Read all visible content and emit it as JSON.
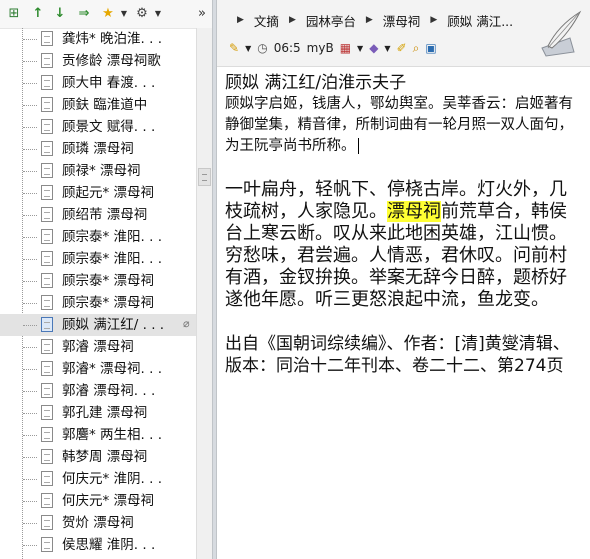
{
  "left_toolbar": {
    "buttons": [
      "add-node",
      "up",
      "down",
      "right",
      "favorite",
      "more"
    ],
    "collapse": "»"
  },
  "tree": {
    "items": [
      {
        "label": "龚炜* 晚泊淮. . ."
      },
      {
        "label": "贡修龄 漂母祠歌"
      },
      {
        "label": "顾大申 春渡. . ."
      },
      {
        "label": "顾鈇 臨淮道中"
      },
      {
        "label": "顾景文 赋得. . ."
      },
      {
        "label": "顾璘 漂母祠"
      },
      {
        "label": "顾禄* 漂母祠"
      },
      {
        "label": "顾起元* 漂母祠"
      },
      {
        "label": "顾绍芾 漂母祠"
      },
      {
        "label": "顾宗泰* 淮阳. . ."
      },
      {
        "label": "顾宗泰* 淮阳. . ."
      },
      {
        "label": "顾宗泰* 漂母祠"
      },
      {
        "label": "顾宗泰* 漂母祠"
      },
      {
        "label": "顾姒 满江红/ . . .",
        "selected": true
      },
      {
        "label": "郭濬 漂母祠"
      },
      {
        "label": "郭濬* 漂母祠. . ."
      },
      {
        "label": "郭濬 漂母祠. . ."
      },
      {
        "label": "郭孔建 漂母祠"
      },
      {
        "label": "郭麐* 两生相. . ."
      },
      {
        "label": "韩梦周 漂母祠"
      },
      {
        "label": "何庆元* 淮阴. . ."
      },
      {
        "label": "何庆元* 漂母祠"
      },
      {
        "label": "贺炌 漂母祠"
      },
      {
        "label": "侯思耀 淮阴. . ."
      }
    ]
  },
  "breadcrumb": [
    "文摘",
    "园林亭台",
    "漂母祠",
    "顾姒 满江..."
  ],
  "toolbar": {
    "time": "06:5",
    "size": "myB"
  },
  "document": {
    "title": "顾姒 满江红/泊淮示夫子",
    "desc": "顾姒字启姬，钱唐人，鄂幼舆室。吴莘香云：启姬著有静御堂集，精音律，所制词曲有一轮月照一双人面句，为王阮亭尚书所称。",
    "poem1_before": "一叶扁舟，轻帆下、停桡古岸。灯火外，几枝疏树，人家隐见。",
    "poem1_hl": "漂母祠",
    "poem1_after": "前荒草合，韩侯台上寒云断。叹从来此地困英雄，江山惯。",
    "poem2": "穷愁味，君尝遍。人情恶，君休叹。问前村有酒，金钗拚换。举案无辞今日醉，题桥好遂他年愿。听三更怒浪起中流，鱼龙变。",
    "source": "出自《国朝词综续编》、作者：[清]黄燮清辑、版本：同治十二年刊本、卷二十二、第274页"
  }
}
